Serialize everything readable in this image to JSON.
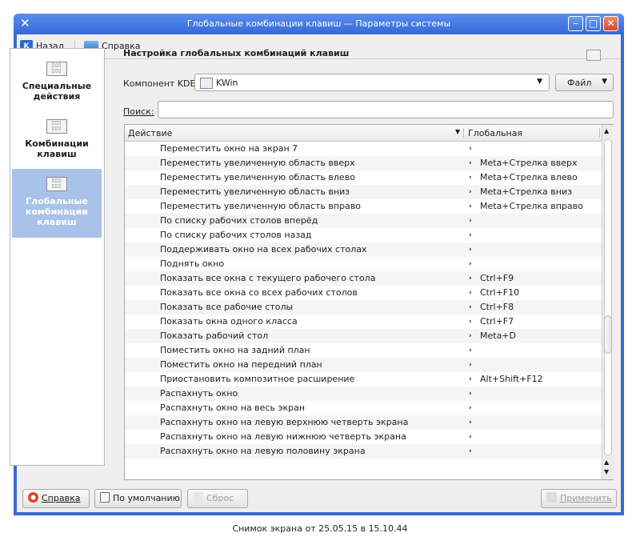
{
  "window": {
    "title": "Глобальные комбинации клавиш — Параметры системы",
    "controls": [
      "minimize",
      "maximize",
      "close"
    ]
  },
  "toolbar": {
    "back_label": "Назад",
    "help_label": "Справка"
  },
  "sidebar": {
    "items": [
      {
        "label": "Специальные действия",
        "selected": false
      },
      {
        "label": "Комбинации клавиш",
        "selected": false
      },
      {
        "label": "Глобальные комбинации клавиш",
        "selected": true
      }
    ]
  },
  "main": {
    "title": "Настройка глобальных комбинаций клавиш",
    "component_label": "Компонент KDE:",
    "component_value": "KWin",
    "file_button": "Файл",
    "search_label": "Поиск:",
    "search_value": "",
    "columns": [
      "Действие",
      "Глобальная"
    ],
    "rows": [
      {
        "action": "Переместить окно на экран 7",
        "key": ""
      },
      {
        "action": "Переместить увеличенную область вверх",
        "key": "Meta+Стрелка вверх"
      },
      {
        "action": "Переместить увеличенную область влево",
        "key": "Meta+Стрелка влево"
      },
      {
        "action": "Переместить увеличенную область вниз",
        "key": "Meta+Стрелка вниз"
      },
      {
        "action": "Переместить увеличенную область вправо",
        "key": "Meta+Стрелка вправо"
      },
      {
        "action": "По списку рабочих столов вперёд",
        "key": ""
      },
      {
        "action": "По списку рабочих столов назад",
        "key": ""
      },
      {
        "action": "Поддерживать окно на всех рабочих столах",
        "key": ""
      },
      {
        "action": "Поднять окно",
        "key": ""
      },
      {
        "action": "Показать все окна с текущего рабочего стола",
        "key": "Ctrl+F9"
      },
      {
        "action": "Показать все окна со всех рабочих столов",
        "key": "Ctrl+F10"
      },
      {
        "action": "Показать все рабочие столы",
        "key": "Ctrl+F8"
      },
      {
        "action": "Показать окна одного класса",
        "key": "Ctrl+F7"
      },
      {
        "action": "Показать рабочий стол",
        "key": "Meta+D"
      },
      {
        "action": "Поместить окно на задний план",
        "key": ""
      },
      {
        "action": "Поместить окно на передний план",
        "key": ""
      },
      {
        "action": "Приостановить композитное расширение",
        "key": "Alt+Shift+F12"
      },
      {
        "action": "Распахнуть окно",
        "key": ""
      },
      {
        "action": "Распахнуть окно на весь экран",
        "key": ""
      },
      {
        "action": "Распахнуть окно на левую верхнюю четверть экрана",
        "key": ""
      },
      {
        "action": "Распахнуть окно на левую нижнюю четверть экрана",
        "key": ""
      },
      {
        "action": "Распахнуть окно на левую половину экрана",
        "key": ""
      }
    ]
  },
  "buttons": {
    "help": "Справка",
    "defaults": "По умолчанию",
    "reset": "Сброс",
    "apply": "Применить"
  },
  "caption": "Снимок экрана от 25.05.15 в 15.10.44"
}
